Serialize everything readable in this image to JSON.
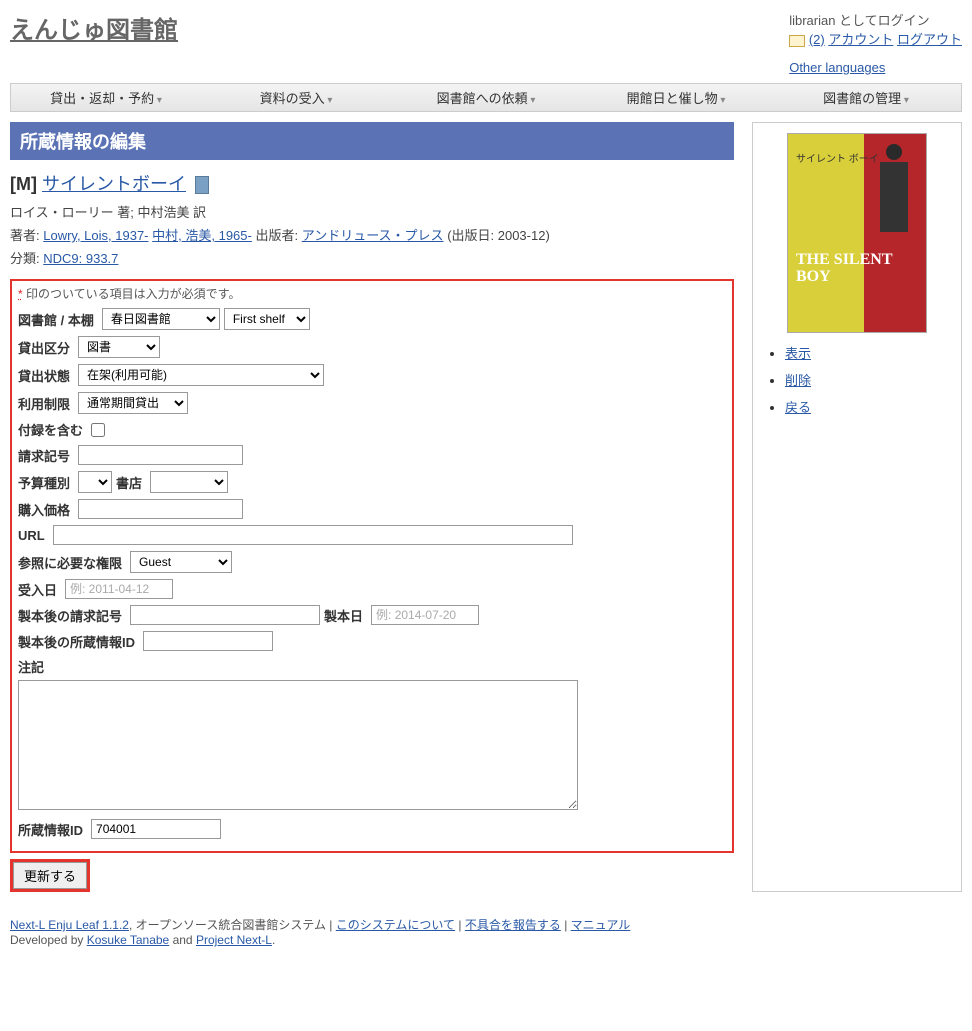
{
  "header": {
    "site_title": "えんじゅ図書館",
    "login_status": "librarian としてログイン",
    "msg_count": "(2)",
    "account_link": "アカウント",
    "logout_link": "ログアウト",
    "other_languages": "Other languages"
  },
  "nav": {
    "items": [
      "貸出・返却・予約",
      "資料の受入",
      "図書館への依頼",
      "開館日と催し物",
      "図書館の管理"
    ]
  },
  "section": {
    "title": "所蔵情報の編集"
  },
  "biblio": {
    "type_mark": "[M]",
    "title_link": "サイレントボーイ",
    "author_line": "ロイス・ローリー 著; 中村浩美 訳",
    "creator_label": "著者:",
    "creators": [
      "Lowry, Lois, 1937-",
      "中村, 浩美, 1965-"
    ],
    "publisher_label": "出版者:",
    "publisher": "アンドリュース・プレス",
    "pubdate": "(出版日: 2003-12)",
    "classification_label": "分類:",
    "classification": "NDC9: 933.7"
  },
  "form": {
    "required_note_prefix": "*",
    "required_note": "印のついている項目は入力が必須です。",
    "labels": {
      "library_shelf": "図書館 / 本棚",
      "checkout_type": "貸出区分",
      "circulation_status": "貸出状態",
      "use_restriction": "利用制限",
      "include_supplements": "付録を含む",
      "call_number": "請求記号",
      "budget_type": "予算種別",
      "bookstore": "書店",
      "price": "購入価格",
      "url": "URL",
      "required_role": "参照に必要な権限",
      "acquired_at": "受入日",
      "binding_call_number": "製本後の請求記号",
      "binded_at": "製本日",
      "binding_item_identifier": "製本後の所蔵情報ID",
      "note": "注記",
      "item_identifier": "所蔵情報ID"
    },
    "values": {
      "library": "春日図書館",
      "shelf": "First shelf",
      "checkout_type": "図書",
      "circulation_status": "在架(利用可能)",
      "use_restriction": "通常期間貸出",
      "include_supplements": false,
      "call_number": "",
      "budget_type": "",
      "bookstore": "",
      "price": "",
      "url": "",
      "required_role": "Guest",
      "acquired_at": "",
      "binding_call_number": "",
      "binded_at": "",
      "binding_item_identifier": "",
      "note": "",
      "item_identifier": "704001"
    },
    "placeholders": {
      "acquired_at": "例: 2011-04-12",
      "binded_at": "例: 2014-07-20"
    },
    "submit": "更新する"
  },
  "sidebar": {
    "cover_jp": "サイレント ボーイ",
    "cover_en": "THE SILENT BOY",
    "links": [
      "表示",
      "削除",
      "戻る"
    ]
  },
  "footer": {
    "product": "Next-L Enju Leaf 1.1.2",
    "tagline": ", オープンソース統合図書館システム |",
    "about": "このシステムについて",
    "sep1": " | ",
    "report_bug": "不具合を報告する",
    "sep2": " | ",
    "manual": "マニュアル",
    "developed": "Developed by ",
    "dev1": "Kosuke Tanabe",
    "and": " and ",
    "dev2": "Project Next-L",
    "period": "."
  }
}
